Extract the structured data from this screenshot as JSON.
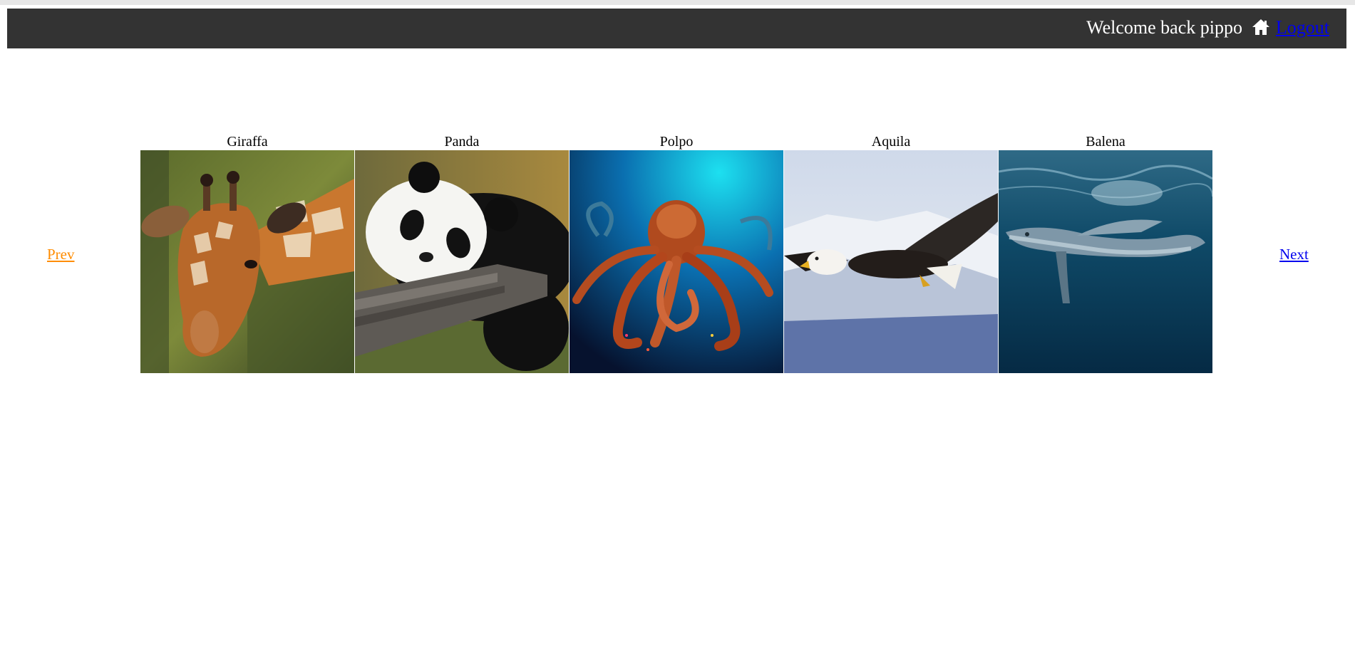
{
  "header": {
    "welcome_text": "Welcome back pippo",
    "logout_label": "Logout",
    "home_icon": "home-icon",
    "background": "#333333"
  },
  "gallery": {
    "prev_label": "Prev",
    "next_label": "Next",
    "prev_color": "#ff8c00",
    "next_color": "#0000ee",
    "items": [
      {
        "caption": "Giraffa",
        "image": "giraffe-photo"
      },
      {
        "caption": "Panda",
        "image": "panda-photo"
      },
      {
        "caption": "Polpo",
        "image": "octopus-photo"
      },
      {
        "caption": "Aquila",
        "image": "eagle-photo"
      },
      {
        "caption": "Balena",
        "image": "whale-photo"
      }
    ]
  }
}
